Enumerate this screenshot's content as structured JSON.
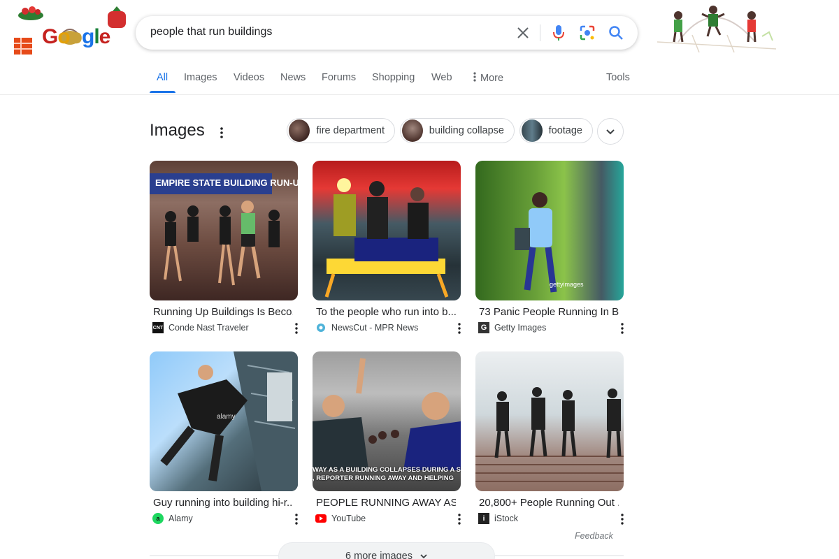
{
  "search": {
    "query": "people that run buildings"
  },
  "logo": {
    "text": "Google"
  },
  "tabs": [
    {
      "label": "All",
      "active": true
    },
    {
      "label": "Images"
    },
    {
      "label": "Videos"
    },
    {
      "label": "News"
    },
    {
      "label": "Forums"
    },
    {
      "label": "Shopping"
    },
    {
      "label": "Web"
    },
    {
      "label": "More"
    }
  ],
  "tools_label": "Tools",
  "images_section": {
    "title": "Images",
    "chips": [
      {
        "label": "fire department"
      },
      {
        "label": "building collapse"
      },
      {
        "label": "footage"
      }
    ],
    "results": [
      {
        "title": "Running Up Buildings Is Beco...",
        "source": "Conde Nast Traveler",
        "favicon": "CNT",
        "overlay_text": "EMPIRE STATE BUILDING RUN-UP"
      },
      {
        "title": "To the people who run into b...",
        "source": "NewsCut - MPR News",
        "favicon": "mpr"
      },
      {
        "title": "73 Panic People Running In B...",
        "source": "Getty Images",
        "favicon": "G",
        "watermark": "gettyimages"
      },
      {
        "title": "Guy running into building hi-r...",
        "source": "Alamy",
        "favicon": "a",
        "watermark": "alamy"
      },
      {
        "title": "PEOPLE RUNNING AWAY AS ...",
        "source": "YouTube",
        "favicon": "yt",
        "caption_lines": [
          "WAY AS A BUILDING COLLAPSES DURING A SE",
          ", REPORTER RUNNING AWAY AND HELPING"
        ]
      },
      {
        "title": "20,800+ People Running Out ...",
        "source": "iStock",
        "favicon": "i"
      }
    ],
    "feedback_label": "Feedback",
    "more_images_label": "6 more images"
  },
  "colors": {
    "accent": "#1a73e8",
    "text": "#202124",
    "muted": "#5f6368"
  }
}
